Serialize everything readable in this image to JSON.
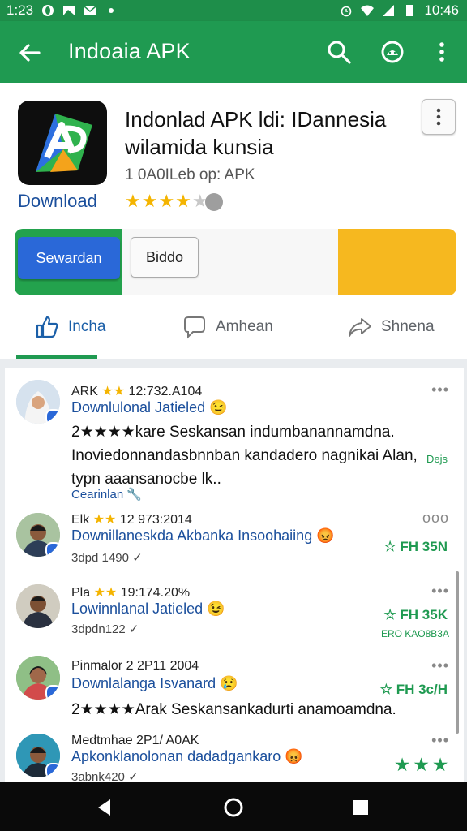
{
  "status_bar": {
    "time": "1:23",
    "clock_right": "10:46",
    "colors": {
      "bar": "#1e8e4a"
    }
  },
  "app_bar": {
    "title": "Indoaia APK",
    "back_icon": "arrow-left-icon",
    "search_icon": "search-icon",
    "account_icon": "android-icon",
    "menu_icon": "more-vert-icon",
    "color": "#1f9a51"
  },
  "app": {
    "name": "Indonlad APK ldi: IDannesia wilamida kunsia",
    "subtitle": "1 0A0ILeb op: APK",
    "download_label": "Download",
    "rating_stars": 4,
    "primary_button": "Sewardan",
    "secondary_button": "Biddo"
  },
  "tabs": [
    {
      "label": "Incha",
      "icon": "thumbs-up-icon",
      "active": true
    },
    {
      "label": "Amhean",
      "icon": "comment-icon",
      "active": false
    },
    {
      "label": "Shnena",
      "icon": "share-icon",
      "active": false
    }
  ],
  "reviews": [
    {
      "name": "ARK",
      "stars": "★★",
      "date": "12:732.A104",
      "title": "Downlulonal Jatieled 😉",
      "body": "2★★★★kare Seskansan indumbanannamdna. Inoviedonnandasbnnban kandadero nagnikai Alan, typn aaansanocbe lk..",
      "side": "Dejs",
      "link": "Cearinlan 🔧",
      "meta": "",
      "side_small": ""
    },
    {
      "name": "Elk",
      "stars": "★★",
      "date": "12 973:2014",
      "title": "Downillaneskda Akbanka Insoohaiing 😡",
      "body": "",
      "meta": "3dpd 1490",
      "side": "☆ FH 35N",
      "link": "",
      "side_small": ""
    },
    {
      "name": "Pla",
      "stars": "★★",
      "date": "19:174.20%",
      "title": "Lowinnlanal Jatieled 😉",
      "body": "",
      "meta": "3dpdn122",
      "side": "☆ FH 35K",
      "link": "",
      "side_small": "ERO KAO8B3A"
    },
    {
      "name": "Pinmalor 2",
      "stars": "",
      "date": "2P11 2004",
      "title": "Downlalanga Isvanard 😢",
      "body": "2★★★★Arak Seskansankadurti anamoamdna.",
      "meta": "",
      "side": "☆ FH 3c/H",
      "link": "",
      "side_small": ""
    },
    {
      "name": "Medtmhae",
      "stars": "",
      "date": "2P1/ A0AK",
      "title": "Apkonklanolonan dadadgankaro 😡",
      "body": "",
      "meta": "3abnk420",
      "side": "★ ★ ★",
      "link": "",
      "side_small": ""
    }
  ]
}
